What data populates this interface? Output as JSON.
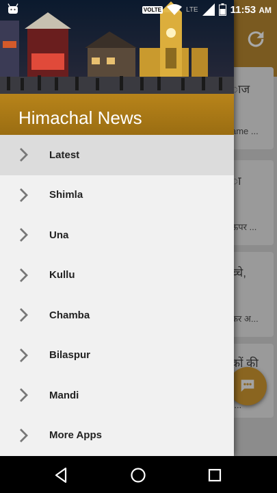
{
  "status_bar": {
    "time": "11:53",
    "time_suffix": "AM",
    "volte": "VOLTE",
    "network": "LTE"
  },
  "background_app": {
    "cards": [
      {
        "title": "ाज",
        "desc": "ame ..."
      },
      {
        "title": "ा",
        "desc": "ऊपर ..."
      },
      {
        "title": "च्चे,",
        "desc": "कर अ..."
      },
      {
        "title": "कों की",
        "desc": "(..."
      }
    ]
  },
  "drawer": {
    "title": "Himachal News",
    "items": [
      {
        "label": "Latest",
        "active": true
      },
      {
        "label": "Shimla",
        "active": false
      },
      {
        "label": "Una",
        "active": false
      },
      {
        "label": "Kullu",
        "active": false
      },
      {
        "label": "Chamba",
        "active": false
      },
      {
        "label": "Bilaspur",
        "active": false
      },
      {
        "label": "Mandi",
        "active": false
      },
      {
        "label": "More Apps",
        "active": false
      }
    ]
  },
  "colors": {
    "accent": "#b8841a",
    "drawer_bg": "#f1f1f1",
    "active_item_bg": "#dcdcdc"
  }
}
